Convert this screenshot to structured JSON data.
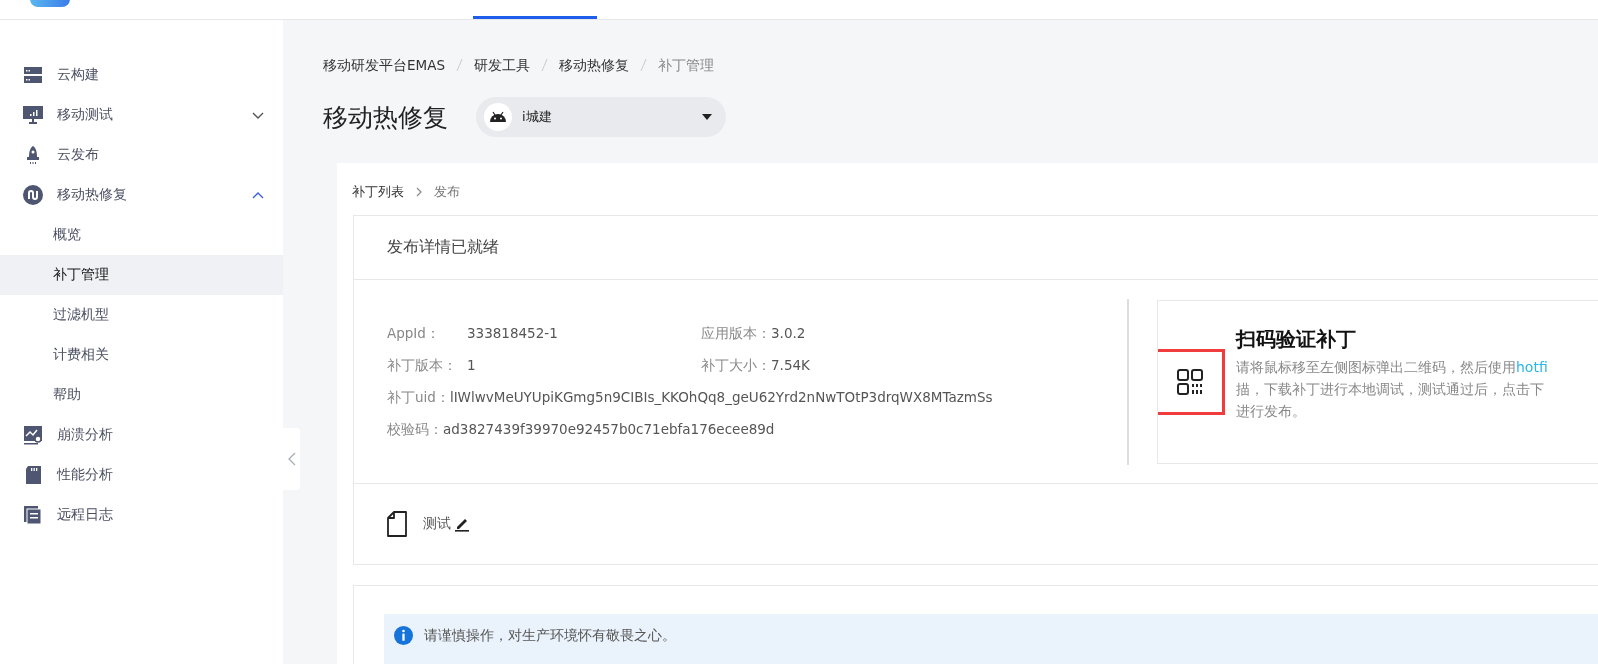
{
  "sidebar": {
    "items": [
      {
        "label": "云构建",
        "selected": false
      },
      {
        "label": "移动测试",
        "expanded": false,
        "selected": false
      },
      {
        "label": "云发布",
        "selected": false
      },
      {
        "label": "移动热修复",
        "expanded": true,
        "selected": false,
        "children": [
          {
            "label": "概览",
            "selected": false
          },
          {
            "label": "补丁管理",
            "selected": true
          },
          {
            "label": "过滤机型",
            "selected": false
          },
          {
            "label": "计费相关",
            "selected": false
          },
          {
            "label": "帮助",
            "selected": false
          }
        ]
      },
      {
        "label": "崩溃分析",
        "selected": false
      },
      {
        "label": "性能分析",
        "selected": false
      },
      {
        "label": "远程日志",
        "selected": false
      }
    ]
  },
  "breadcrumb": [
    "移动研发平台EMAS",
    "研发工具",
    "移动热修复",
    "补丁管理"
  ],
  "page_title": "移动热修复",
  "app_select": {
    "value": "i城建"
  },
  "sub_breadcrumb": [
    "补丁列表",
    "发布"
  ],
  "card": {
    "title": "发布详情已就绪",
    "details": [
      [
        {
          "label": "AppId：",
          "value": "333818452-1"
        },
        {
          "label": "应用版本：",
          "value": "3.0.2"
        }
      ],
      [
        {
          "label": "补丁版本：",
          "value": "1"
        },
        {
          "label": "补丁大小：",
          "value": "7.54K"
        }
      ],
      [
        {
          "label": "补丁uid：",
          "value": "lIWlwvMeUYUpiKGmg5n9CIBIs_KKOhQq8_geU62Yrd2nNwTOtP3drqWX8MTazmSs"
        }
      ],
      [
        {
          "label": "校验码：",
          "value": "ad3827439f39970e92457b0c71ebfa176ecee89d"
        }
      ]
    ],
    "scan": {
      "title": "扫码验证补丁",
      "lines": [
        {
          "text": "请将鼠标移至左侧图标弹出二维码，然后使用",
          "link": "hotfi"
        },
        {
          "text": "描，下载补丁进行本地调试，测试通过后，点击下"
        },
        {
          "text": "进行发布。"
        }
      ]
    },
    "patch_name": "测试"
  },
  "alert": {
    "text": "请谨慎操作，对生产环境怀有敬畏之心。"
  }
}
